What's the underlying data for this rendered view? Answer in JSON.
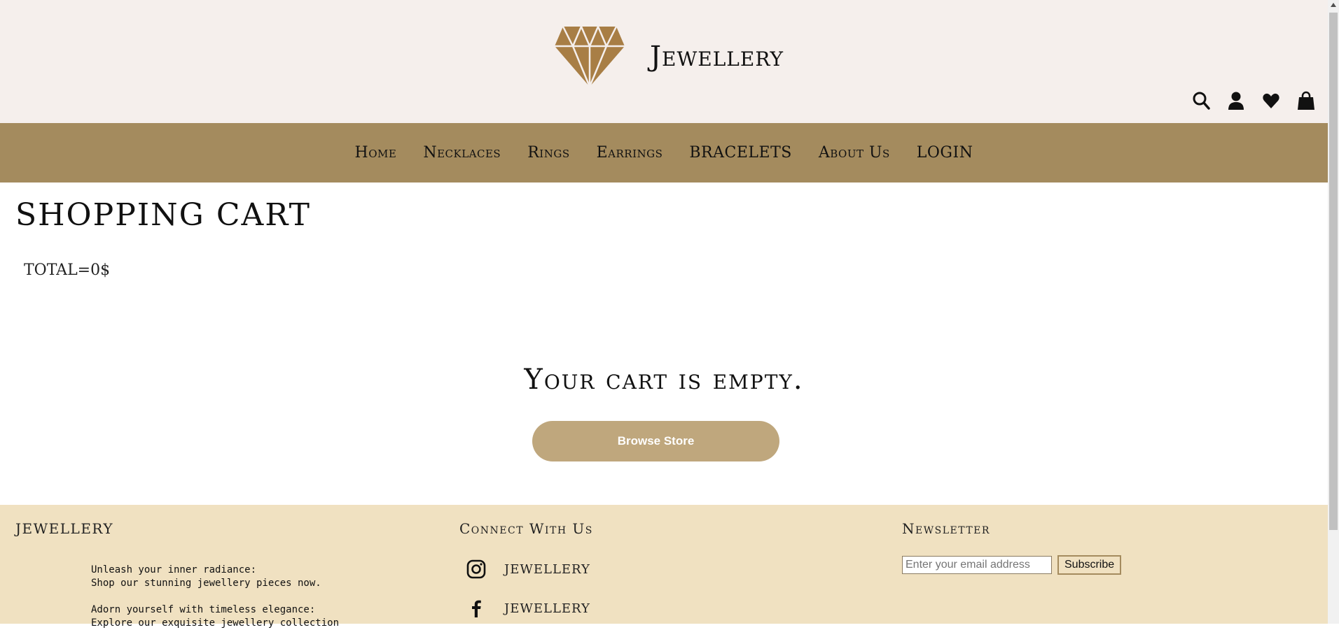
{
  "header": {
    "brand": "Jewellery",
    "icons": [
      "search-icon",
      "user-icon",
      "heart-icon",
      "bag-icon"
    ]
  },
  "nav": {
    "items": [
      "Home",
      "Necklaces",
      "Rings",
      "Earrings",
      "BRACELETS",
      "About Us",
      "LOGIN"
    ]
  },
  "cart": {
    "title": "SHOPPING CART",
    "total": "TOTAL=0$",
    "empty_message": "Your cart is empty.",
    "browse_button": "Browse Store"
  },
  "footer": {
    "col1_title": "JEWELLERY",
    "tagline": "Unleash your inner radiance:\nShop our stunning jewellery pieces now.\n\nAdorn yourself with timeless elegance:\nExplore our exquisite jewellery collection",
    "col2_title": "Connect With Us",
    "social": [
      {
        "icon": "instagram-icon",
        "label": "JEWELLERY"
      },
      {
        "icon": "facebook-icon",
        "label": "JEWELLERY"
      }
    ],
    "col3_title": "Newsletter",
    "email_placeholder": "Enter your email address",
    "subscribe_label": "Subscribe"
  },
  "colors": {
    "header_bg": "#f5efec",
    "nav_bg": "#a48b5e",
    "button_bg": "#bfa77d",
    "footer_bg": "#f0e1c1",
    "logo": "#a87e45"
  }
}
